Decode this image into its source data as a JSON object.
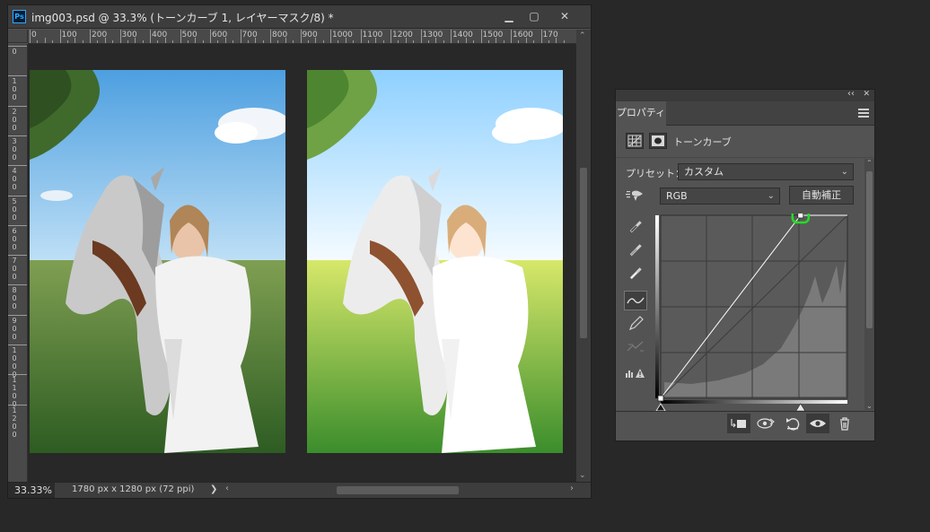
{
  "document": {
    "title": "img003.psd @ 33.3% (トーンカーブ 1, レイヤーマスク/8) *",
    "app_icon": "Ps",
    "window_buttons": {
      "minimize": "▁",
      "restore": "▢",
      "close": "✕"
    },
    "ruler_top_labels": [
      "0",
      "100",
      "200",
      "300",
      "400",
      "500",
      "600",
      "700",
      "800",
      "900",
      "1000",
      "1100",
      "1200",
      "1300",
      "1400",
      "1500",
      "1600",
      "170"
    ],
    "ruler_left_labels": [
      "0",
      "1\n0\n0",
      "2\n0\n0",
      "3\n0\n0",
      "4\n0\n0",
      "5\n0\n0",
      "6\n0\n0",
      "7\n0\n0",
      "8\n0\n0",
      "9\n0\n0",
      "1\n0\n0\n0",
      "1\n1\n0\n0",
      "1\n2\n0\n0"
    ],
    "status": {
      "zoom": "33.33%",
      "doc_info": "1780 px x 1280 px (72 ppi)",
      "arrow": "❯"
    }
  },
  "properties": {
    "tab_label": "プロパティ",
    "adjustment_title": "トーンカーブ",
    "preset_label": "プリセット：",
    "preset_value": "カスタム",
    "channel_value": "RGB",
    "auto_button": "自動補正",
    "highlight_color": "#22dd22",
    "collapse_icon": "‹‹",
    "close_icon": "✕"
  },
  "curve": {
    "input_range": [
      0,
      255
    ],
    "output_range": [
      0,
      255
    ],
    "points": [
      [
        0,
        0
      ],
      [
        191,
        255
      ]
    ],
    "selected_point": [
      191,
      255
    ]
  }
}
